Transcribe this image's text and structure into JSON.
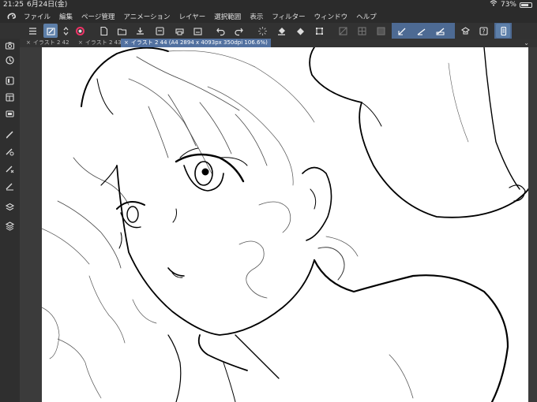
{
  "status": {
    "time": "21:25",
    "date": "6月24日(金)",
    "battery": "73%",
    "battery_level": 0.73
  },
  "menu": [
    "ファイル",
    "編集",
    "ページ管理",
    "アニメーション",
    "レイヤー",
    "選択範囲",
    "表示",
    "フィルター",
    "ウィンドウ",
    "ヘルプ"
  ],
  "tabs": [
    {
      "close": "×",
      "label": "イラスト 2 42"
    },
    {
      "close": "×",
      "label": "イラスト 2 43"
    },
    {
      "close": "×",
      "label": "イラスト 2 44 (A4 2894 x 4093px 350dpi 106.6%)"
    }
  ],
  "tabs_chevron": "⌄",
  "colors": {
    "accent": "#5d7fa9",
    "active_tab": "#5271a0",
    "toolbar_group": "#4d6a93",
    "canvas": "#ffffff"
  }
}
